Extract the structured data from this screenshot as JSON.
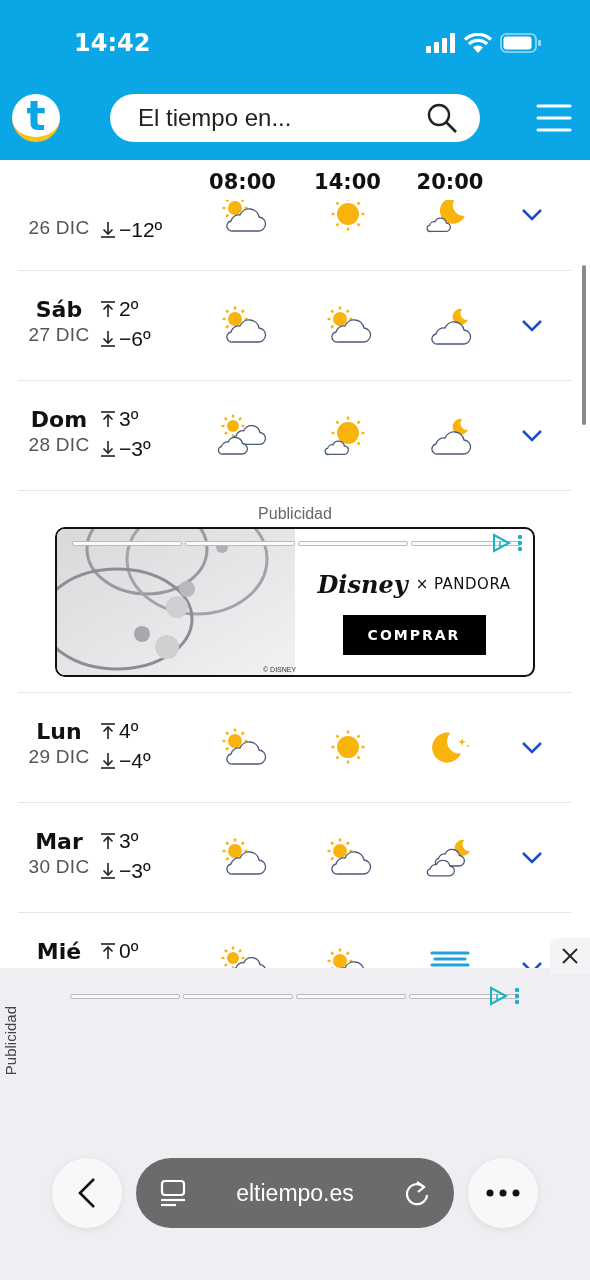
{
  "status_bar": {
    "time": "14:42"
  },
  "header": {
    "logo": "t",
    "search": {
      "placeholder": "El tiempo en..."
    }
  },
  "forecast": {
    "hours": [
      "08:00",
      "14:00",
      "20:00"
    ],
    "days": [
      {
        "date": "26 DIC",
        "min": "−12º",
        "icons": [
          {
            "kind": "sun_cloud"
          },
          {
            "kind": "sun"
          },
          {
            "kind": "moon_cloud_small"
          }
        ]
      },
      {
        "day": "Sáb",
        "date": "27 DIC",
        "max": "2º",
        "min": "−6º",
        "icons": [
          {
            "kind": "sun_cloud"
          },
          {
            "kind": "sun_cloud"
          },
          {
            "kind": "moon_cloud"
          }
        ]
      },
      {
        "day": "Dom",
        "date": "28 DIC",
        "max": "3º",
        "min": "−3º",
        "icons": [
          {
            "kind": "sun_two_clouds"
          },
          {
            "kind": "sun_big_cloud_small"
          },
          {
            "kind": "moon_cloud"
          }
        ]
      },
      {
        "kind": "ad",
        "label": "Publicidad",
        "brand": "Disney",
        "partner": "× PANDORA",
        "credit": "© DISNEY",
        "button": "COMPRAR"
      },
      {
        "day": "Lun",
        "date": "29 DIC",
        "max": "4º",
        "min": "−4º",
        "icons": [
          {
            "kind": "sun_cloud"
          },
          {
            "kind": "sun"
          },
          {
            "kind": "moon"
          }
        ]
      },
      {
        "day": "Mar",
        "date": "30 DIC",
        "max": "3º",
        "min": "−3º",
        "icons": [
          {
            "kind": "sun_cloud"
          },
          {
            "kind": "sun_cloud"
          },
          {
            "kind": "moon_two_clouds"
          }
        ]
      },
      {
        "day": "Mié",
        "max": "0º",
        "icons": [
          {
            "kind": "sun_two_clouds"
          },
          {
            "kind": "sun_cloud"
          },
          {
            "kind": "fog"
          }
        ]
      }
    ]
  },
  "bottom_ad": {
    "label": "Publicidad"
  },
  "browser": {
    "url": "eltiempo.es"
  }
}
